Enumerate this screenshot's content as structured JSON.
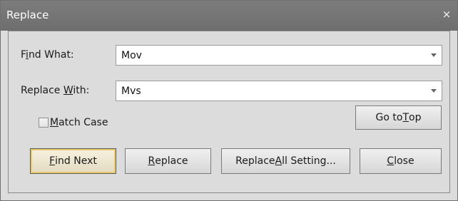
{
  "window": {
    "title": "Replace",
    "close_glyph": "×"
  },
  "find": {
    "label_pre": "F",
    "label_mn": "i",
    "label_post": "nd What:",
    "value": "Mov",
    "dropdown_icon": "chevron-down-icon"
  },
  "replace": {
    "label_pre": "Replace ",
    "label_mn": "W",
    "label_post": "ith:",
    "value": "Mvs",
    "dropdown_icon": "chevron-down-icon"
  },
  "match_case": {
    "label_mn": "M",
    "label_post": "atch Case",
    "checked": false
  },
  "buttons": {
    "go_to_top": {
      "pre": "Go to ",
      "mn": "T",
      "post": "op"
    },
    "find_next": {
      "pre": "",
      "mn": "F",
      "post": "ind Next"
    },
    "replace": {
      "pre": "",
      "mn": "R",
      "post": "eplace"
    },
    "replace_all": {
      "pre": "Replace ",
      "mn": "A",
      "post": "ll Setting..."
    },
    "close": {
      "pre": "",
      "mn": "C",
      "post": "lose"
    }
  },
  "colors": {
    "titlebar": "#757575",
    "dialog_bg": "#dcdcdc",
    "default_button_ring": "#e9c96a"
  }
}
